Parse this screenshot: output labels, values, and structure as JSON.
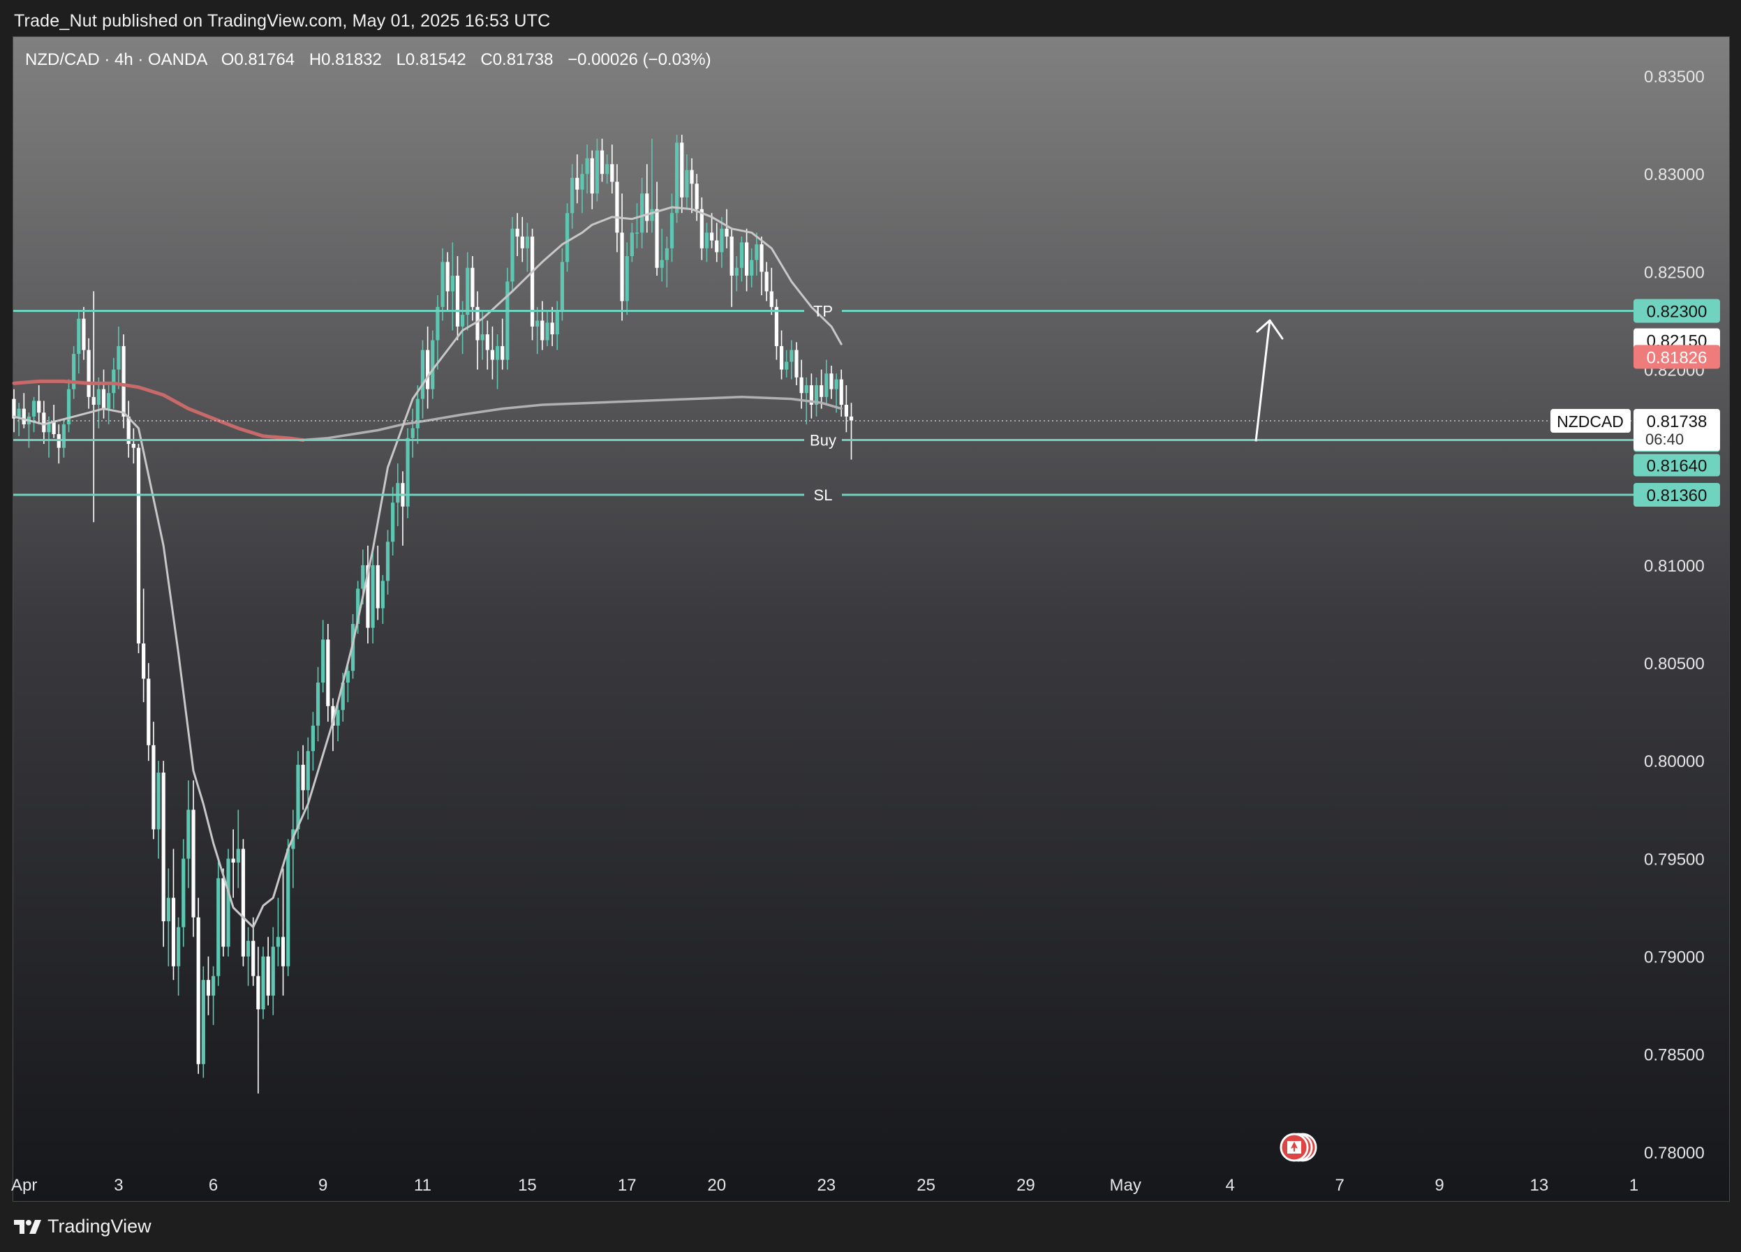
{
  "header": {
    "published": "Trade_Nut published on TradingView.com, May 01, 2025 16:53 UTC"
  },
  "legend": {
    "symbol_line": "NZD/CAD · 4h · OANDA",
    "o": "O0.81764",
    "h": "H0.81832",
    "l": "L0.81542",
    "c": "C0.81738",
    "change": "−0.00026 (−0.03%)"
  },
  "footer": {
    "brand": "TradingView"
  },
  "colors": {
    "bull": "#5ec7b2",
    "bear": "#ffffff",
    "ma_fast": "#c8c8c8",
    "ma_slow": "#c96a6a",
    "ma_mid": "#b0b0b0",
    "level": "#6fd3c0",
    "current_red": "#f07b7b"
  },
  "chart_data": {
    "type": "candlestick",
    "symbol": "NZD/CAD",
    "timeframe": "4h",
    "broker": "OANDA",
    "ylim": [
      0.7775,
      0.837
    ],
    "y_ticks": [
      "0.83500",
      "0.83000",
      "0.82500",
      "0.82000",
      "0.81500",
      "0.81000",
      "0.80500",
      "0.80000",
      "0.79500",
      "0.79000",
      "0.78500",
      "0.78000"
    ],
    "y_tick_values": [
      0.835,
      0.83,
      0.825,
      0.82,
      0.815,
      0.81,
      0.805,
      0.8,
      0.795,
      0.79,
      0.785,
      0.78
    ],
    "x_labels": [
      "Apr",
      "3",
      "6",
      "9",
      "11",
      "15",
      "17",
      "20",
      "23",
      "25",
      "29",
      "May",
      "4",
      "7",
      "9",
      "13",
      "1"
    ],
    "x_label_index": [
      0,
      21,
      40,
      62,
      82,
      103,
      123,
      141,
      163,
      183,
      203,
      223,
      244,
      266,
      286,
      306,
      325
    ],
    "bar_count": 327,
    "candles": [
      [
        0.8185,
        0.819,
        0.8168,
        0.8175
      ],
      [
        0.8175,
        0.8183,
        0.8166,
        0.818
      ],
      [
        0.818,
        0.8188,
        0.817,
        0.8172
      ],
      [
        0.8172,
        0.8178,
        0.816,
        0.8176
      ],
      [
        0.8176,
        0.8186,
        0.8168,
        0.8184
      ],
      [
        0.8184,
        0.8192,
        0.8172,
        0.8178
      ],
      [
        0.8178,
        0.8184,
        0.8162,
        0.8168
      ],
      [
        0.8168,
        0.8176,
        0.8155,
        0.8173
      ],
      [
        0.8173,
        0.8182,
        0.8165,
        0.8167
      ],
      [
        0.8167,
        0.8172,
        0.8152,
        0.816
      ],
      [
        0.816,
        0.8175,
        0.8155,
        0.8172
      ],
      [
        0.8172,
        0.8195,
        0.8168,
        0.819
      ],
      [
        0.819,
        0.8212,
        0.8185,
        0.8208
      ],
      [
        0.8208,
        0.823,
        0.8198,
        0.8226
      ],
      [
        0.8226,
        0.8232,
        0.8205,
        0.821
      ],
      [
        0.821,
        0.8216,
        0.818,
        0.8186
      ],
      [
        0.8186,
        0.824,
        0.8122,
        0.8182
      ],
      [
        0.8182,
        0.8196,
        0.817,
        0.819
      ],
      [
        0.819,
        0.82,
        0.8175,
        0.818
      ],
      [
        0.818,
        0.8192,
        0.8172,
        0.8188
      ],
      [
        0.8188,
        0.8206,
        0.818,
        0.82
      ],
      [
        0.82,
        0.8222,
        0.819,
        0.8212
      ],
      [
        0.8212,
        0.8218,
        0.817,
        0.8176
      ],
      [
        0.8176,
        0.8184,
        0.8155,
        0.8162
      ],
      [
        0.8162,
        0.817,
        0.8152,
        0.816
      ],
      [
        0.816,
        0.8162,
        0.8055,
        0.806
      ],
      [
        0.806,
        0.8088,
        0.803,
        0.8042
      ],
      [
        0.8042,
        0.805,
        0.8,
        0.8008
      ],
      [
        0.8008,
        0.802,
        0.796,
        0.7965
      ],
      [
        0.7965,
        0.8,
        0.795,
        0.7994
      ],
      [
        0.7994,
        0.8,
        0.7905,
        0.7918
      ],
      [
        0.7918,
        0.7945,
        0.7895,
        0.793
      ],
      [
        0.793,
        0.7955,
        0.7888,
        0.7895
      ],
      [
        0.7895,
        0.792,
        0.788,
        0.7915
      ],
      [
        0.7915,
        0.796,
        0.7905,
        0.795
      ],
      [
        0.795,
        0.799,
        0.7935,
        0.7975
      ],
      [
        0.7975,
        0.799,
        0.791,
        0.792
      ],
      [
        0.792,
        0.793,
        0.784,
        0.7845
      ],
      [
        0.7845,
        0.7895,
        0.7838,
        0.7888
      ],
      [
        0.7888,
        0.79,
        0.787,
        0.788
      ],
      [
        0.788,
        0.7895,
        0.7865,
        0.789
      ],
      [
        0.789,
        0.795,
        0.7885,
        0.794
      ],
      [
        0.794,
        0.7945,
        0.79,
        0.7905
      ],
      [
        0.7905,
        0.7955,
        0.79,
        0.795
      ],
      [
        0.795,
        0.7965,
        0.793,
        0.7948
      ],
      [
        0.7948,
        0.7975,
        0.7935,
        0.7955
      ],
      [
        0.7955,
        0.796,
        0.7895,
        0.79
      ],
      [
        0.79,
        0.7915,
        0.7885,
        0.7908
      ],
      [
        0.7908,
        0.792,
        0.7885,
        0.789
      ],
      [
        0.789,
        0.7905,
        0.783,
        0.7873
      ],
      [
        0.7873,
        0.7905,
        0.7868,
        0.79
      ],
      [
        0.79,
        0.791,
        0.7875,
        0.788
      ],
      [
        0.788,
        0.7915,
        0.787,
        0.7905
      ],
      [
        0.7905,
        0.793,
        0.7895,
        0.791
      ],
      [
        0.791,
        0.7945,
        0.788,
        0.7895
      ],
      [
        0.7895,
        0.796,
        0.789,
        0.7955
      ],
      [
        0.7955,
        0.7975,
        0.7935,
        0.7965
      ],
      [
        0.7965,
        0.8005,
        0.796,
        0.7998
      ],
      [
        0.7998,
        0.8008,
        0.7975,
        0.7985
      ],
      [
        0.7985,
        0.8012,
        0.797,
        0.8005
      ],
      [
        0.8005,
        0.8025,
        0.7995,
        0.8018
      ],
      [
        0.8018,
        0.8048,
        0.801,
        0.804
      ],
      [
        0.804,
        0.8072,
        0.8035,
        0.8062
      ],
      [
        0.8062,
        0.807,
        0.802,
        0.8028
      ],
      [
        0.8028,
        0.8032,
        0.8005,
        0.8018
      ],
      [
        0.8018,
        0.803,
        0.801,
        0.8026
      ],
      [
        0.8026,
        0.8045,
        0.802,
        0.804
      ],
      [
        0.804,
        0.805,
        0.803,
        0.8046
      ],
      [
        0.8046,
        0.8075,
        0.8042,
        0.807
      ],
      [
        0.807,
        0.8092,
        0.8065,
        0.8088
      ],
      [
        0.8088,
        0.8108,
        0.808,
        0.81
      ],
      [
        0.81,
        0.811,
        0.806,
        0.8068
      ],
      [
        0.8068,
        0.8108,
        0.806,
        0.81
      ],
      [
        0.81,
        0.811,
        0.8072,
        0.8078
      ],
      [
        0.8078,
        0.8095,
        0.807,
        0.8092
      ],
      [
        0.8092,
        0.8118,
        0.8085,
        0.8112
      ],
      [
        0.8112,
        0.814,
        0.8105,
        0.8132
      ],
      [
        0.8132,
        0.8152,
        0.812,
        0.8142
      ],
      [
        0.8142,
        0.8148,
        0.811,
        0.813
      ],
      [
        0.813,
        0.817,
        0.8124,
        0.8165
      ],
      [
        0.8165,
        0.818,
        0.8155,
        0.817
      ],
      [
        0.817,
        0.8192,
        0.8162,
        0.8185
      ],
      [
        0.8185,
        0.8215,
        0.8175,
        0.821
      ],
      [
        0.821,
        0.8222,
        0.818,
        0.819
      ],
      [
        0.819,
        0.822,
        0.8185,
        0.8215
      ],
      [
        0.8215,
        0.8238,
        0.82,
        0.8232
      ],
      [
        0.8232,
        0.8262,
        0.8225,
        0.8255
      ],
      [
        0.8255,
        0.826,
        0.823,
        0.824
      ],
      [
        0.824,
        0.8265,
        0.822,
        0.8248
      ],
      [
        0.8248,
        0.8258,
        0.8215,
        0.8222
      ],
      [
        0.8222,
        0.8235,
        0.8208,
        0.8228
      ],
      [
        0.8228,
        0.826,
        0.822,
        0.8252
      ],
      [
        0.8252,
        0.8258,
        0.8225,
        0.8232
      ],
      [
        0.8232,
        0.824,
        0.82,
        0.8215
      ],
      [
        0.8215,
        0.823,
        0.8205,
        0.8218
      ],
      [
        0.8218,
        0.8225,
        0.82,
        0.821
      ],
      [
        0.821,
        0.8222,
        0.8195,
        0.8205
      ],
      [
        0.8205,
        0.8218,
        0.819,
        0.8212
      ],
      [
        0.8212,
        0.8226,
        0.82,
        0.8205
      ],
      [
        0.8205,
        0.8252,
        0.82,
        0.8245
      ],
      [
        0.8245,
        0.8278,
        0.824,
        0.8272
      ],
      [
        0.8272,
        0.828,
        0.8258,
        0.8268
      ],
      [
        0.8268,
        0.8278,
        0.8255,
        0.8262
      ],
      [
        0.8262,
        0.8275,
        0.825,
        0.8268
      ],
      [
        0.8268,
        0.8272,
        0.8215,
        0.8222
      ],
      [
        0.8222,
        0.8232,
        0.8208,
        0.8225
      ],
      [
        0.8225,
        0.8235,
        0.821,
        0.8215
      ],
      [
        0.8215,
        0.823,
        0.8212,
        0.8224
      ],
      [
        0.8224,
        0.8232,
        0.8212,
        0.8218
      ],
      [
        0.8218,
        0.8235,
        0.821,
        0.823
      ],
      [
        0.823,
        0.8262,
        0.8225,
        0.8255
      ],
      [
        0.8255,
        0.8285,
        0.825,
        0.828
      ],
      [
        0.828,
        0.8305,
        0.8272,
        0.8298
      ],
      [
        0.8298,
        0.831,
        0.8285,
        0.8292
      ],
      [
        0.8292,
        0.8305,
        0.828,
        0.83
      ],
      [
        0.83,
        0.8315,
        0.829,
        0.8308
      ],
      [
        0.8308,
        0.8312,
        0.8282,
        0.829
      ],
      [
        0.829,
        0.8318,
        0.8286,
        0.8312
      ],
      [
        0.8312,
        0.8318,
        0.8296,
        0.83
      ],
      [
        0.83,
        0.831,
        0.8295,
        0.8305
      ],
      [
        0.8305,
        0.8315,
        0.829,
        0.8296
      ],
      [
        0.8296,
        0.8305,
        0.826,
        0.827
      ],
      [
        0.827,
        0.829,
        0.8225,
        0.8235
      ],
      [
        0.8235,
        0.8265,
        0.8228,
        0.8258
      ],
      [
        0.8258,
        0.8275,
        0.8255,
        0.827
      ],
      [
        0.827,
        0.8285,
        0.8262,
        0.827
      ],
      [
        0.827,
        0.8298,
        0.8262,
        0.829
      ],
      [
        0.829,
        0.8305,
        0.827,
        0.8276
      ],
      [
        0.8276,
        0.8318,
        0.827,
        0.8282
      ],
      [
        0.8282,
        0.8296,
        0.8248,
        0.8252
      ],
      [
        0.8252,
        0.8272,
        0.8245,
        0.8256
      ],
      [
        0.8256,
        0.8268,
        0.8242,
        0.8262
      ],
      [
        0.8262,
        0.829,
        0.8255,
        0.828
      ],
      [
        0.828,
        0.832,
        0.8275,
        0.8316
      ],
      [
        0.8316,
        0.832,
        0.828,
        0.8288
      ],
      [
        0.8288,
        0.831,
        0.8282,
        0.8302
      ],
      [
        0.8302,
        0.8308,
        0.828,
        0.8295
      ],
      [
        0.8295,
        0.83,
        0.8276,
        0.8282
      ],
      [
        0.8282,
        0.8288,
        0.8256,
        0.8262
      ],
      [
        0.8262,
        0.8275,
        0.8255,
        0.827
      ],
      [
        0.827,
        0.828,
        0.8262,
        0.8266
      ],
      [
        0.8266,
        0.8275,
        0.8255,
        0.826
      ],
      [
        0.826,
        0.8278,
        0.8252,
        0.8272
      ],
      [
        0.8272,
        0.8282,
        0.8262,
        0.8268
      ],
      [
        0.8268,
        0.8272,
        0.8232,
        0.8248
      ],
      [
        0.8248,
        0.8258,
        0.824,
        0.8252
      ],
      [
        0.8252,
        0.8268,
        0.8245,
        0.8265
      ],
      [
        0.8265,
        0.8272,
        0.824,
        0.8248
      ],
      [
        0.8248,
        0.8262,
        0.8242,
        0.8256
      ],
      [
        0.8256,
        0.827,
        0.8248,
        0.8264
      ],
      [
        0.8264,
        0.8268,
        0.8238,
        0.825
      ],
      [
        0.825,
        0.8255,
        0.8235,
        0.824
      ],
      [
        0.824,
        0.8252,
        0.8228,
        0.8232
      ],
      [
        0.8232,
        0.8236,
        0.8205,
        0.8212
      ],
      [
        0.8212,
        0.822,
        0.8195,
        0.82
      ],
      [
        0.82,
        0.821,
        0.8196,
        0.8204
      ],
      [
        0.8204,
        0.8215,
        0.8195,
        0.821
      ],
      [
        0.821,
        0.8214,
        0.8192,
        0.8196
      ],
      [
        0.8196,
        0.8205,
        0.818,
        0.8188
      ],
      [
        0.8188,
        0.8196,
        0.8172,
        0.8192
      ],
      [
        0.8192,
        0.8198,
        0.8175,
        0.8182
      ],
      [
        0.8182,
        0.8196,
        0.8176,
        0.8192
      ],
      [
        0.8192,
        0.82,
        0.818,
        0.8186
      ],
      [
        0.8186,
        0.8205,
        0.8182,
        0.8198
      ],
      [
        0.8198,
        0.8202,
        0.8185,
        0.819
      ],
      [
        0.819,
        0.8198,
        0.8178,
        0.8195
      ],
      [
        0.8195,
        0.82,
        0.8176,
        0.8182
      ],
      [
        0.8182,
        0.8192,
        0.8168,
        0.8176
      ],
      [
        0.8176,
        0.8183,
        0.8154,
        0.8174
      ]
    ],
    "overlays": {
      "ma_fast": [
        [
          0,
          0.8176
        ],
        [
          6,
          0.8172
        ],
        [
          12,
          0.8176
        ],
        [
          18,
          0.818
        ],
        [
          22,
          0.8178
        ],
        [
          25,
          0.817
        ],
        [
          30,
          0.811
        ],
        [
          33,
          0.8055
        ],
        [
          36,
          0.7995
        ],
        [
          38,
          0.7978
        ],
        [
          40,
          0.7958
        ],
        [
          44,
          0.7925
        ],
        [
          46,
          0.792
        ],
        [
          48,
          0.7915
        ],
        [
          50,
          0.7926
        ],
        [
          52,
          0.793
        ],
        [
          55,
          0.7955
        ],
        [
          59,
          0.7978
        ],
        [
          64,
          0.802
        ],
        [
          68,
          0.806
        ],
        [
          72,
          0.8108
        ],
        [
          75,
          0.815
        ],
        [
          80,
          0.8185
        ],
        [
          84,
          0.82
        ],
        [
          90,
          0.822
        ],
        [
          94,
          0.8226
        ],
        [
          100,
          0.824
        ],
        [
          106,
          0.8255
        ],
        [
          110,
          0.8264
        ],
        [
          114,
          0.827
        ],
        [
          116,
          0.8274
        ],
        [
          120,
          0.8278
        ],
        [
          124,
          0.8277
        ],
        [
          128,
          0.828
        ],
        [
          132,
          0.8283
        ],
        [
          136,
          0.8282
        ],
        [
          140,
          0.8278
        ],
        [
          144,
          0.8272
        ],
        [
          148,
          0.827
        ],
        [
          152,
          0.8262
        ],
        [
          156,
          0.8245
        ],
        [
          160,
          0.8232
        ],
        [
          164,
          0.8222
        ],
        [
          166,
          0.8213
        ]
      ],
      "ma_slow": [
        [
          0,
          0.8193
        ],
        [
          5,
          0.8194
        ],
        [
          10,
          0.8194
        ],
        [
          15,
          0.8193
        ],
        [
          20,
          0.8193
        ],
        [
          25,
          0.8191
        ],
        [
          30,
          0.8187
        ],
        [
          35,
          0.818
        ],
        [
          40,
          0.8175
        ],
        [
          45,
          0.817
        ],
        [
          50,
          0.8166
        ],
        [
          55,
          0.8165
        ],
        [
          58,
          0.8164
        ]
      ],
      "ma_mid": [
        [
          58,
          0.8164
        ],
        [
          63,
          0.8165
        ],
        [
          68,
          0.8167
        ],
        [
          73,
          0.8169
        ],
        [
          78,
          0.8172
        ],
        [
          83,
          0.8174
        ],
        [
          90,
          0.8177
        ],
        [
          98,
          0.818
        ],
        [
          106,
          0.8182
        ],
        [
          116,
          0.8183
        ],
        [
          126,
          0.8184
        ],
        [
          136,
          0.8185
        ],
        [
          146,
          0.8186
        ],
        [
          156,
          0.8185
        ],
        [
          162,
          0.8183
        ],
        [
          166,
          0.818
        ]
      ]
    },
    "levels": [
      {
        "name": "TP",
        "value": 0.823,
        "label": "0.82300"
      },
      {
        "name": "Buy",
        "value": 0.8164,
        "label": "0.81640"
      },
      {
        "name": "SL",
        "value": 0.8136,
        "label": "0.81360"
      }
    ],
    "price_tags": [
      {
        "value": 0.8215,
        "label": "0.82150",
        "style": "white"
      },
      {
        "value": 0.82065,
        "label": "0.81826",
        "style": "red"
      }
    ],
    "current": {
      "symbol": "NZDCAD",
      "value": 0.81738,
      "label": "0.81738",
      "countdown": "06:40"
    },
    "arrow": {
      "from": [
        181,
        0.8174
      ],
      "to": [
        184,
        0.8228
      ]
    }
  }
}
